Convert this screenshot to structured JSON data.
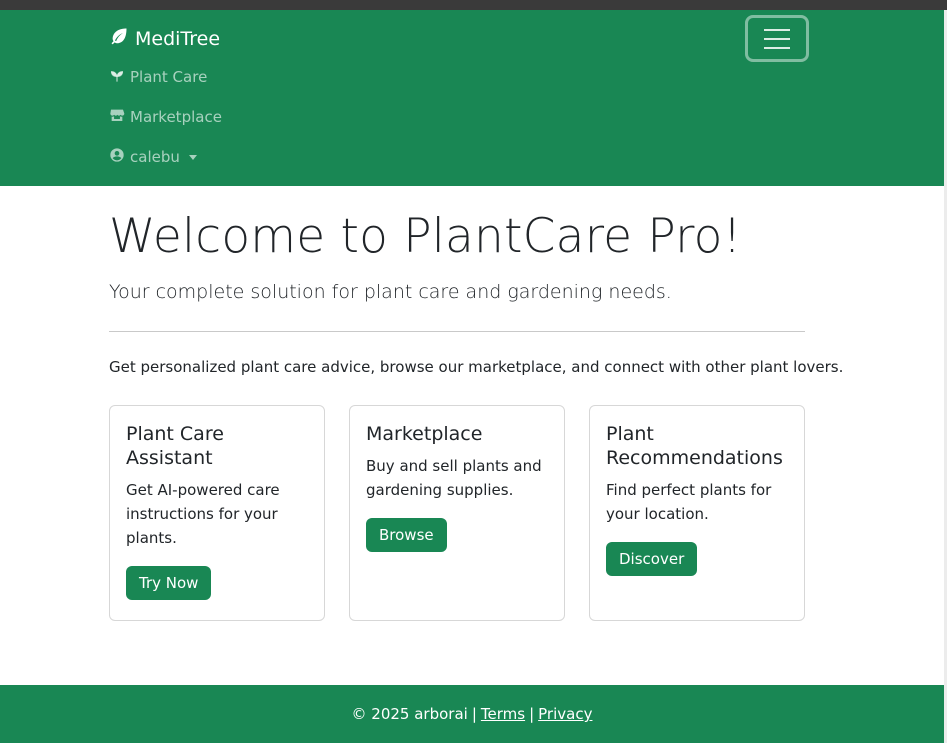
{
  "navbar": {
    "brand": "MediTree",
    "items": [
      {
        "label": "Plant Care",
        "icon": "seedling-icon"
      },
      {
        "label": "Marketplace",
        "icon": "store-icon"
      },
      {
        "label": "calebu",
        "icon": "user-circle-icon"
      }
    ],
    "toggler_icon": "hamburger-menu-icon"
  },
  "hero": {
    "title": "Welcome to PlantCare Pro!",
    "lead": "Your complete solution for plant care and gardening needs.",
    "intro": "Get personalized plant care advice, browse our marketplace, and connect with other plant lovers."
  },
  "cards": [
    {
      "title": "Plant Care Assistant",
      "text": "Get AI-powered care instructions for your plants.",
      "button": "Try Now"
    },
    {
      "title": "Marketplace",
      "text": "Buy and sell plants and gardening supplies.",
      "button": "Browse"
    },
    {
      "title": "Plant Recommendations",
      "text": "Find perfect plants for your location.",
      "button": "Discover"
    }
  ],
  "footer": {
    "copyright": "© 2025 arborai",
    "separator": "|",
    "terms": "Terms",
    "privacy": "Privacy"
  },
  "colors": {
    "primary_green": "#198754",
    "text": "#212529"
  }
}
